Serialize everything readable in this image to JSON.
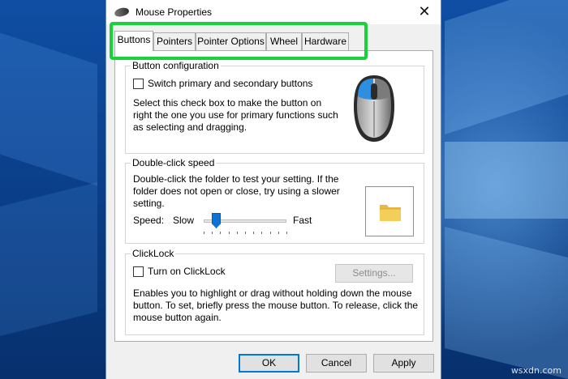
{
  "window": {
    "title": "Mouse Properties",
    "close_glyph": "✕"
  },
  "tabs": [
    {
      "label": "Buttons",
      "active": true
    },
    {
      "label": "Pointers",
      "active": false
    },
    {
      "label": "Pointer Options",
      "active": false
    },
    {
      "label": "Wheel",
      "active": false
    },
    {
      "label": "Hardware",
      "active": false
    }
  ],
  "button_configuration": {
    "legend": "Button configuration",
    "checkbox_label": "Switch primary and secondary buttons",
    "checked": false,
    "description": [
      "Select this check box to make the button on",
      "right the one you use for primary functions such",
      "as selecting and dragging."
    ]
  },
  "double_click": {
    "legend": "Double-click speed",
    "description": [
      "Double-click the folder to test your setting. If the",
      "folder does not open or close, try using a slower",
      "setting."
    ],
    "speed_label": "Speed:",
    "slow_label": "Slow",
    "fast_label": "Fast",
    "speed_level": 0.15
  },
  "clicklock": {
    "legend": "ClickLock",
    "checkbox_label": "Turn on ClickLock",
    "checked": false,
    "settings_button": "Settings...",
    "description": [
      "Enables you to highlight or drag without holding down the mouse",
      "button. To set, briefly press the mouse button. To release, click the",
      "mouse button again."
    ]
  },
  "footer": {
    "ok": "OK",
    "cancel": "Cancel",
    "apply": "Apply"
  },
  "watermark": "wsxdn.com",
  "colors": {
    "highlight": "#19d23a",
    "accent": "#0078d7",
    "folder": "#f3cf5a"
  }
}
